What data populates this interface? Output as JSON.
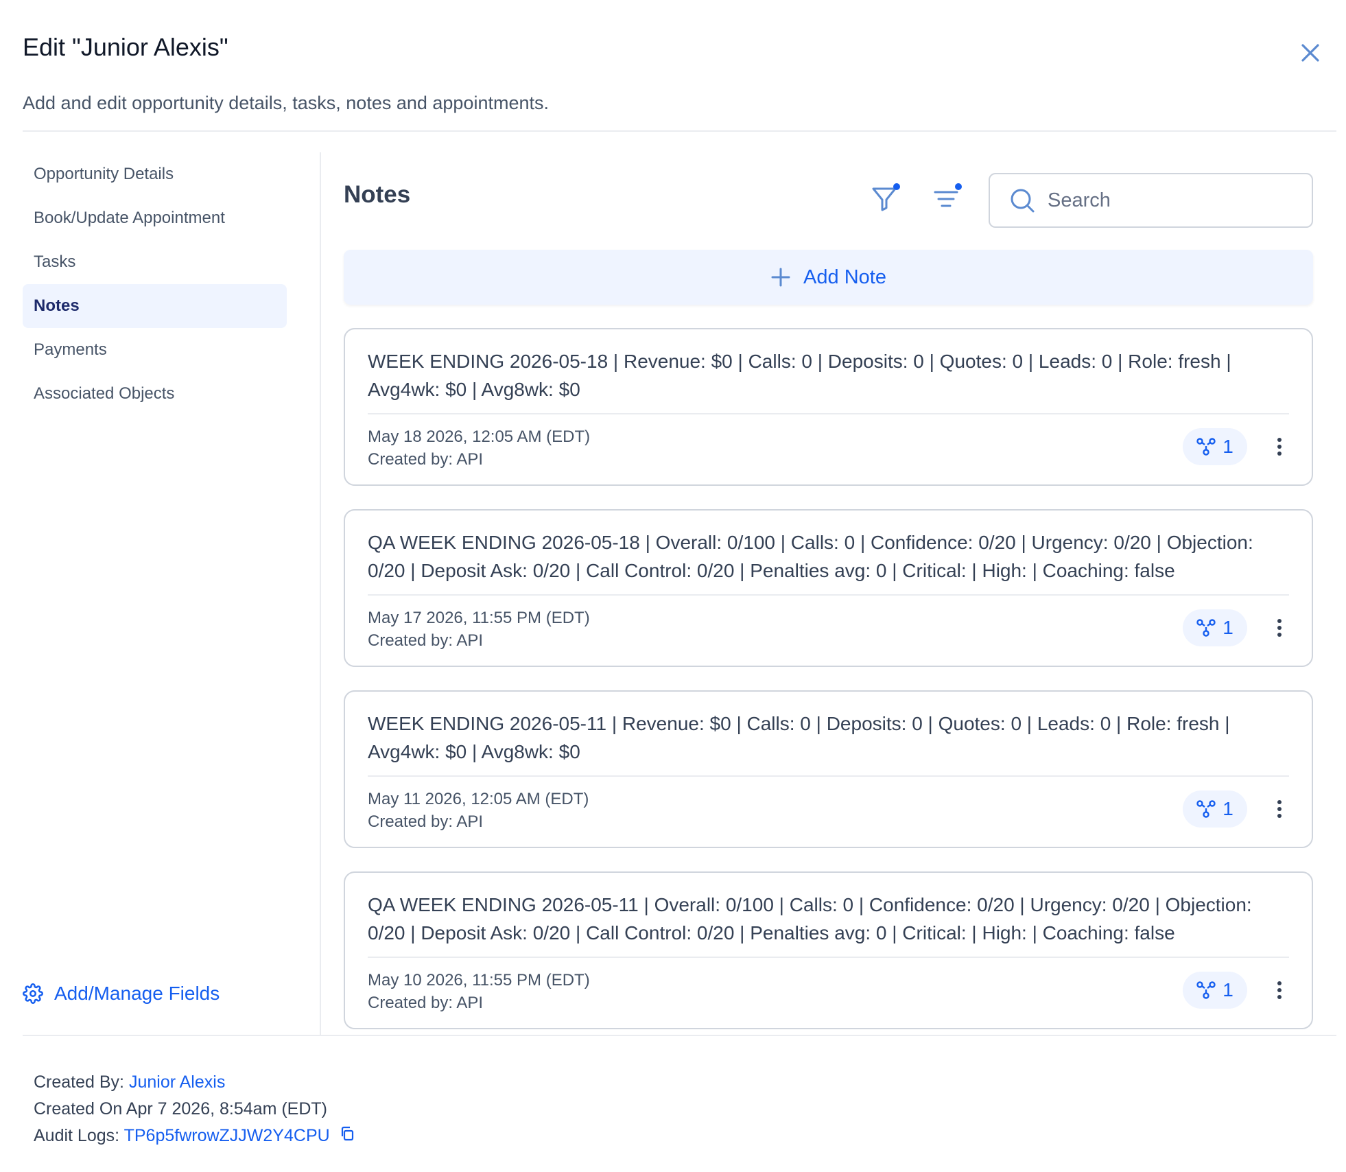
{
  "header": {
    "title": "Edit \"Junior Alexis\"",
    "subtitle": "Add and edit opportunity details, tasks, notes and appointments."
  },
  "sidebar": {
    "items": [
      {
        "label": "Opportunity Details",
        "active": false
      },
      {
        "label": "Book/Update Appointment",
        "active": false
      },
      {
        "label": "Tasks",
        "active": false
      },
      {
        "label": "Notes",
        "active": true
      },
      {
        "label": "Payments",
        "active": false
      },
      {
        "label": "Associated Objects",
        "active": false
      }
    ],
    "manage_fields_label": "Add/Manage Fields"
  },
  "main": {
    "title": "Notes",
    "search": {
      "placeholder": "Search",
      "value": ""
    },
    "add_note_label": "Add Note",
    "notes": [
      {
        "text": "WEEK ENDING 2026-05-18 | Revenue: $0 | Calls: 0 | Deposits: 0 | Quotes: 0 | Leads: 0 | Role: fresh | Avg4wk: $0 | Avg8wk: $0",
        "date": "May 18 2026, 12:05 AM (EDT)",
        "created_by": "Created by: API",
        "assoc_count": "1"
      },
      {
        "text": "QA WEEK ENDING 2026-05-18 | Overall: 0/100 | Calls: 0 | Confidence: 0/20 | Urgency: 0/20 | Objection: 0/20 | Deposit Ask: 0/20 | Call Control: 0/20 | Penalties avg: 0 | Critical:  | High:  | Coaching: false",
        "date": "May 17 2026, 11:55 PM (EDT)",
        "created_by": "Created by: API",
        "assoc_count": "1"
      },
      {
        "text": "WEEK ENDING 2026-05-11 | Revenue: $0 | Calls: 0 | Deposits: 0 | Quotes: 0 | Leads: 0 | Role: fresh | Avg4wk: $0 | Avg8wk: $0",
        "date": "May 11 2026, 12:05 AM (EDT)",
        "created_by": "Created by: API",
        "assoc_count": "1"
      },
      {
        "text": "QA WEEK ENDING 2026-05-11 | Overall: 0/100 | Calls: 0 | Confidence: 0/20 | Urgency: 0/20 | Objection: 0/20 | Deposit Ask: 0/20 | Call Control: 0/20 | Penalties avg: 0 | Critical:  | High:  | Coaching: false",
        "date": "May 10 2026, 11:55 PM (EDT)",
        "created_by": "Created by: API",
        "assoc_count": "1"
      }
    ]
  },
  "footer": {
    "created_by_label": "Created By:",
    "created_by_value": "Junior Alexis",
    "created_on": "Created On Apr 7 2026, 8:54am (EDT)",
    "audit_logs_label": "Audit Logs:",
    "audit_logs_value": "TP6p5fwrowZJJW2Y4CPU"
  },
  "colors": {
    "accent": "#155eef",
    "active_bg": "#eff4ff",
    "border": "#d0d5dd",
    "close_icon": "#5b8ad0"
  },
  "icons": [
    "close-icon",
    "filter-icon",
    "sort-icon",
    "search-icon",
    "plus-icon",
    "association-icon",
    "more-vertical-icon",
    "gear-icon",
    "copy-icon"
  ]
}
